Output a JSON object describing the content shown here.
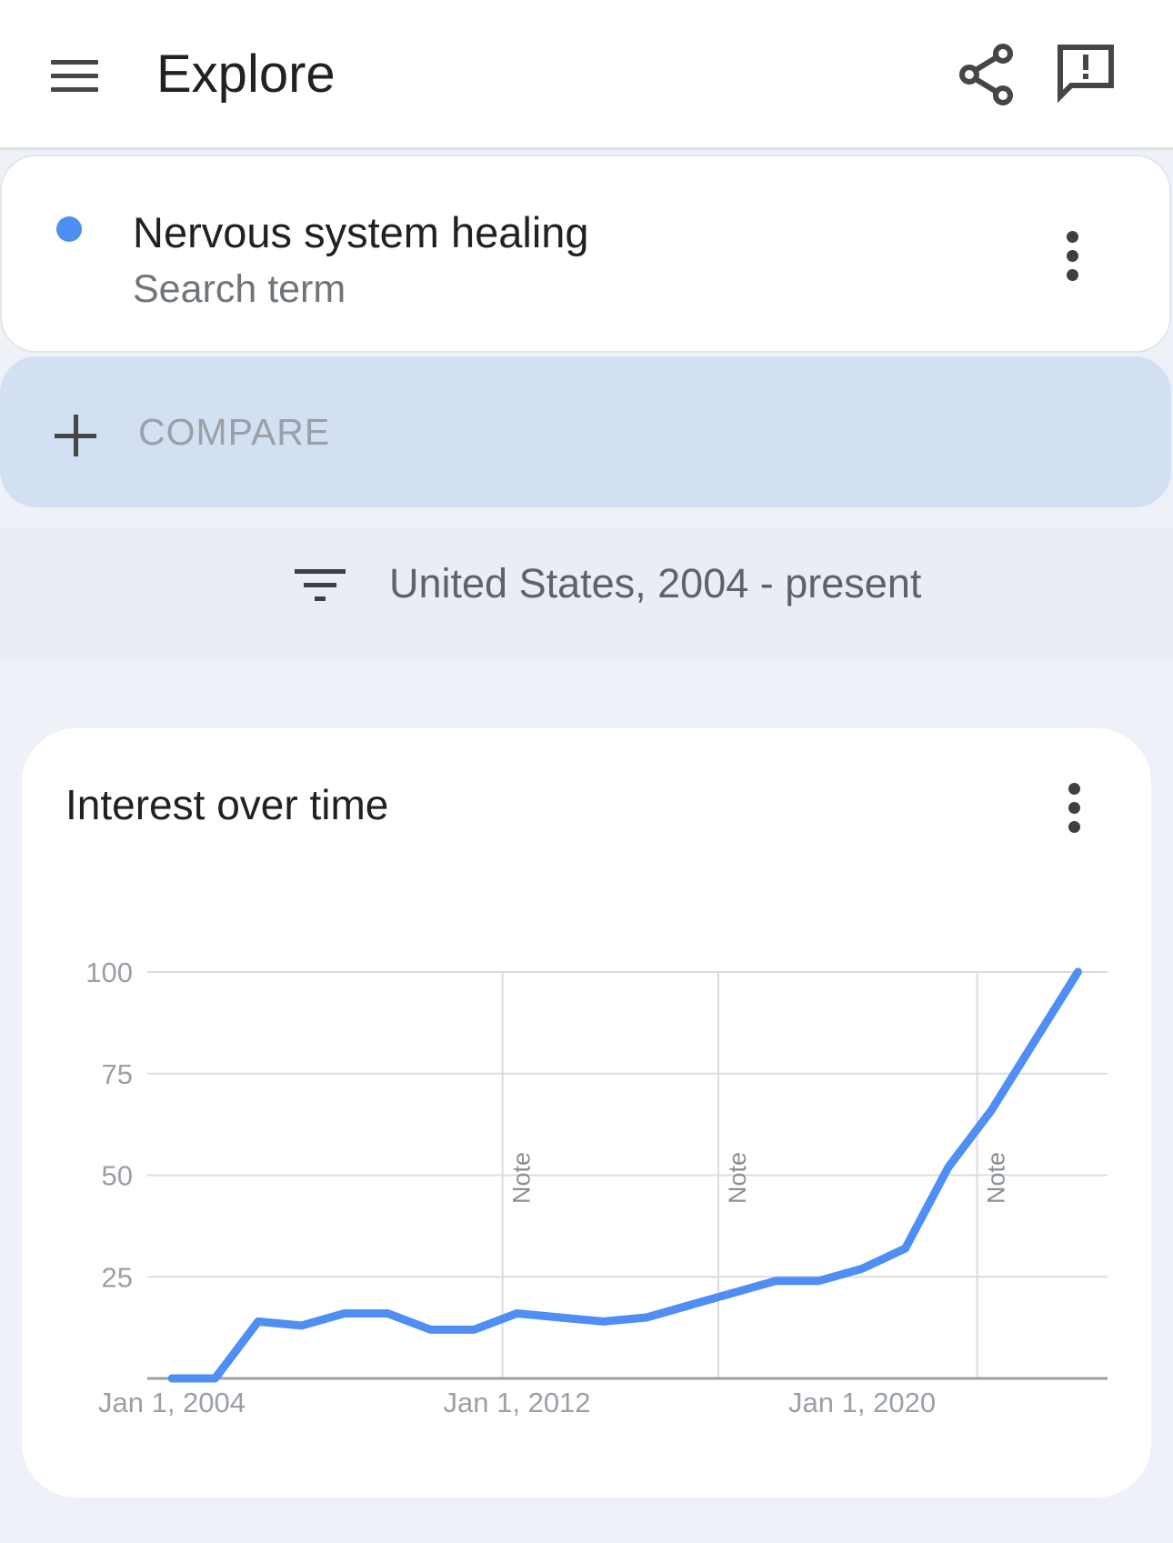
{
  "header": {
    "title": "Explore",
    "menu_icon": "menu-icon",
    "share_icon": "share-icon",
    "feedback_icon": "feedback-icon"
  },
  "term": {
    "name": "Nervous system healing",
    "type": "Search term",
    "color": "#4e8ef5"
  },
  "compare": {
    "label": "COMPARE"
  },
  "filter": {
    "text": "United States, 2004 - present"
  },
  "chart_card": {
    "title": "Interest over time"
  },
  "chart_data": {
    "type": "line",
    "title": "Interest over time",
    "xlabel": "",
    "ylabel": "",
    "ylim": [
      0,
      100
    ],
    "xlim": [
      "2004-01-01",
      "2025-06-01"
    ],
    "yticks": [
      25,
      50,
      75,
      100
    ],
    "xtick_labels": [
      "Jan 1, 2004",
      "Jan 1, 2012",
      "Jan 1, 2020"
    ],
    "xtick_dates": [
      "2004-01-01",
      "2012-01-01",
      "2020-01-01"
    ],
    "grid": true,
    "note_dates": [
      "2011-09-01",
      "2016-09-01",
      "2022-09-01"
    ],
    "note_label": "Note",
    "series": [
      {
        "color": "#4e8ef5",
        "x": [
          "2004-01-01",
          "2005-01-01",
          "2006-01-01",
          "2007-01-01",
          "2008-01-01",
          "2009-01-01",
          "2010-01-01",
          "2011-01-01",
          "2012-01-01",
          "2013-01-01",
          "2014-01-01",
          "2015-01-01",
          "2016-01-01",
          "2017-01-01",
          "2018-01-01",
          "2019-01-01",
          "2020-01-01",
          "2021-01-01",
          "2022-01-01",
          "2023-01-01",
          "2024-01-01",
          "2025-01-01"
        ],
        "y": [
          0,
          0,
          14,
          13,
          16,
          16,
          12,
          12,
          16,
          15,
          14,
          15,
          18,
          21,
          24,
          24,
          27,
          32,
          52,
          66,
          83,
          100
        ]
      }
    ]
  }
}
